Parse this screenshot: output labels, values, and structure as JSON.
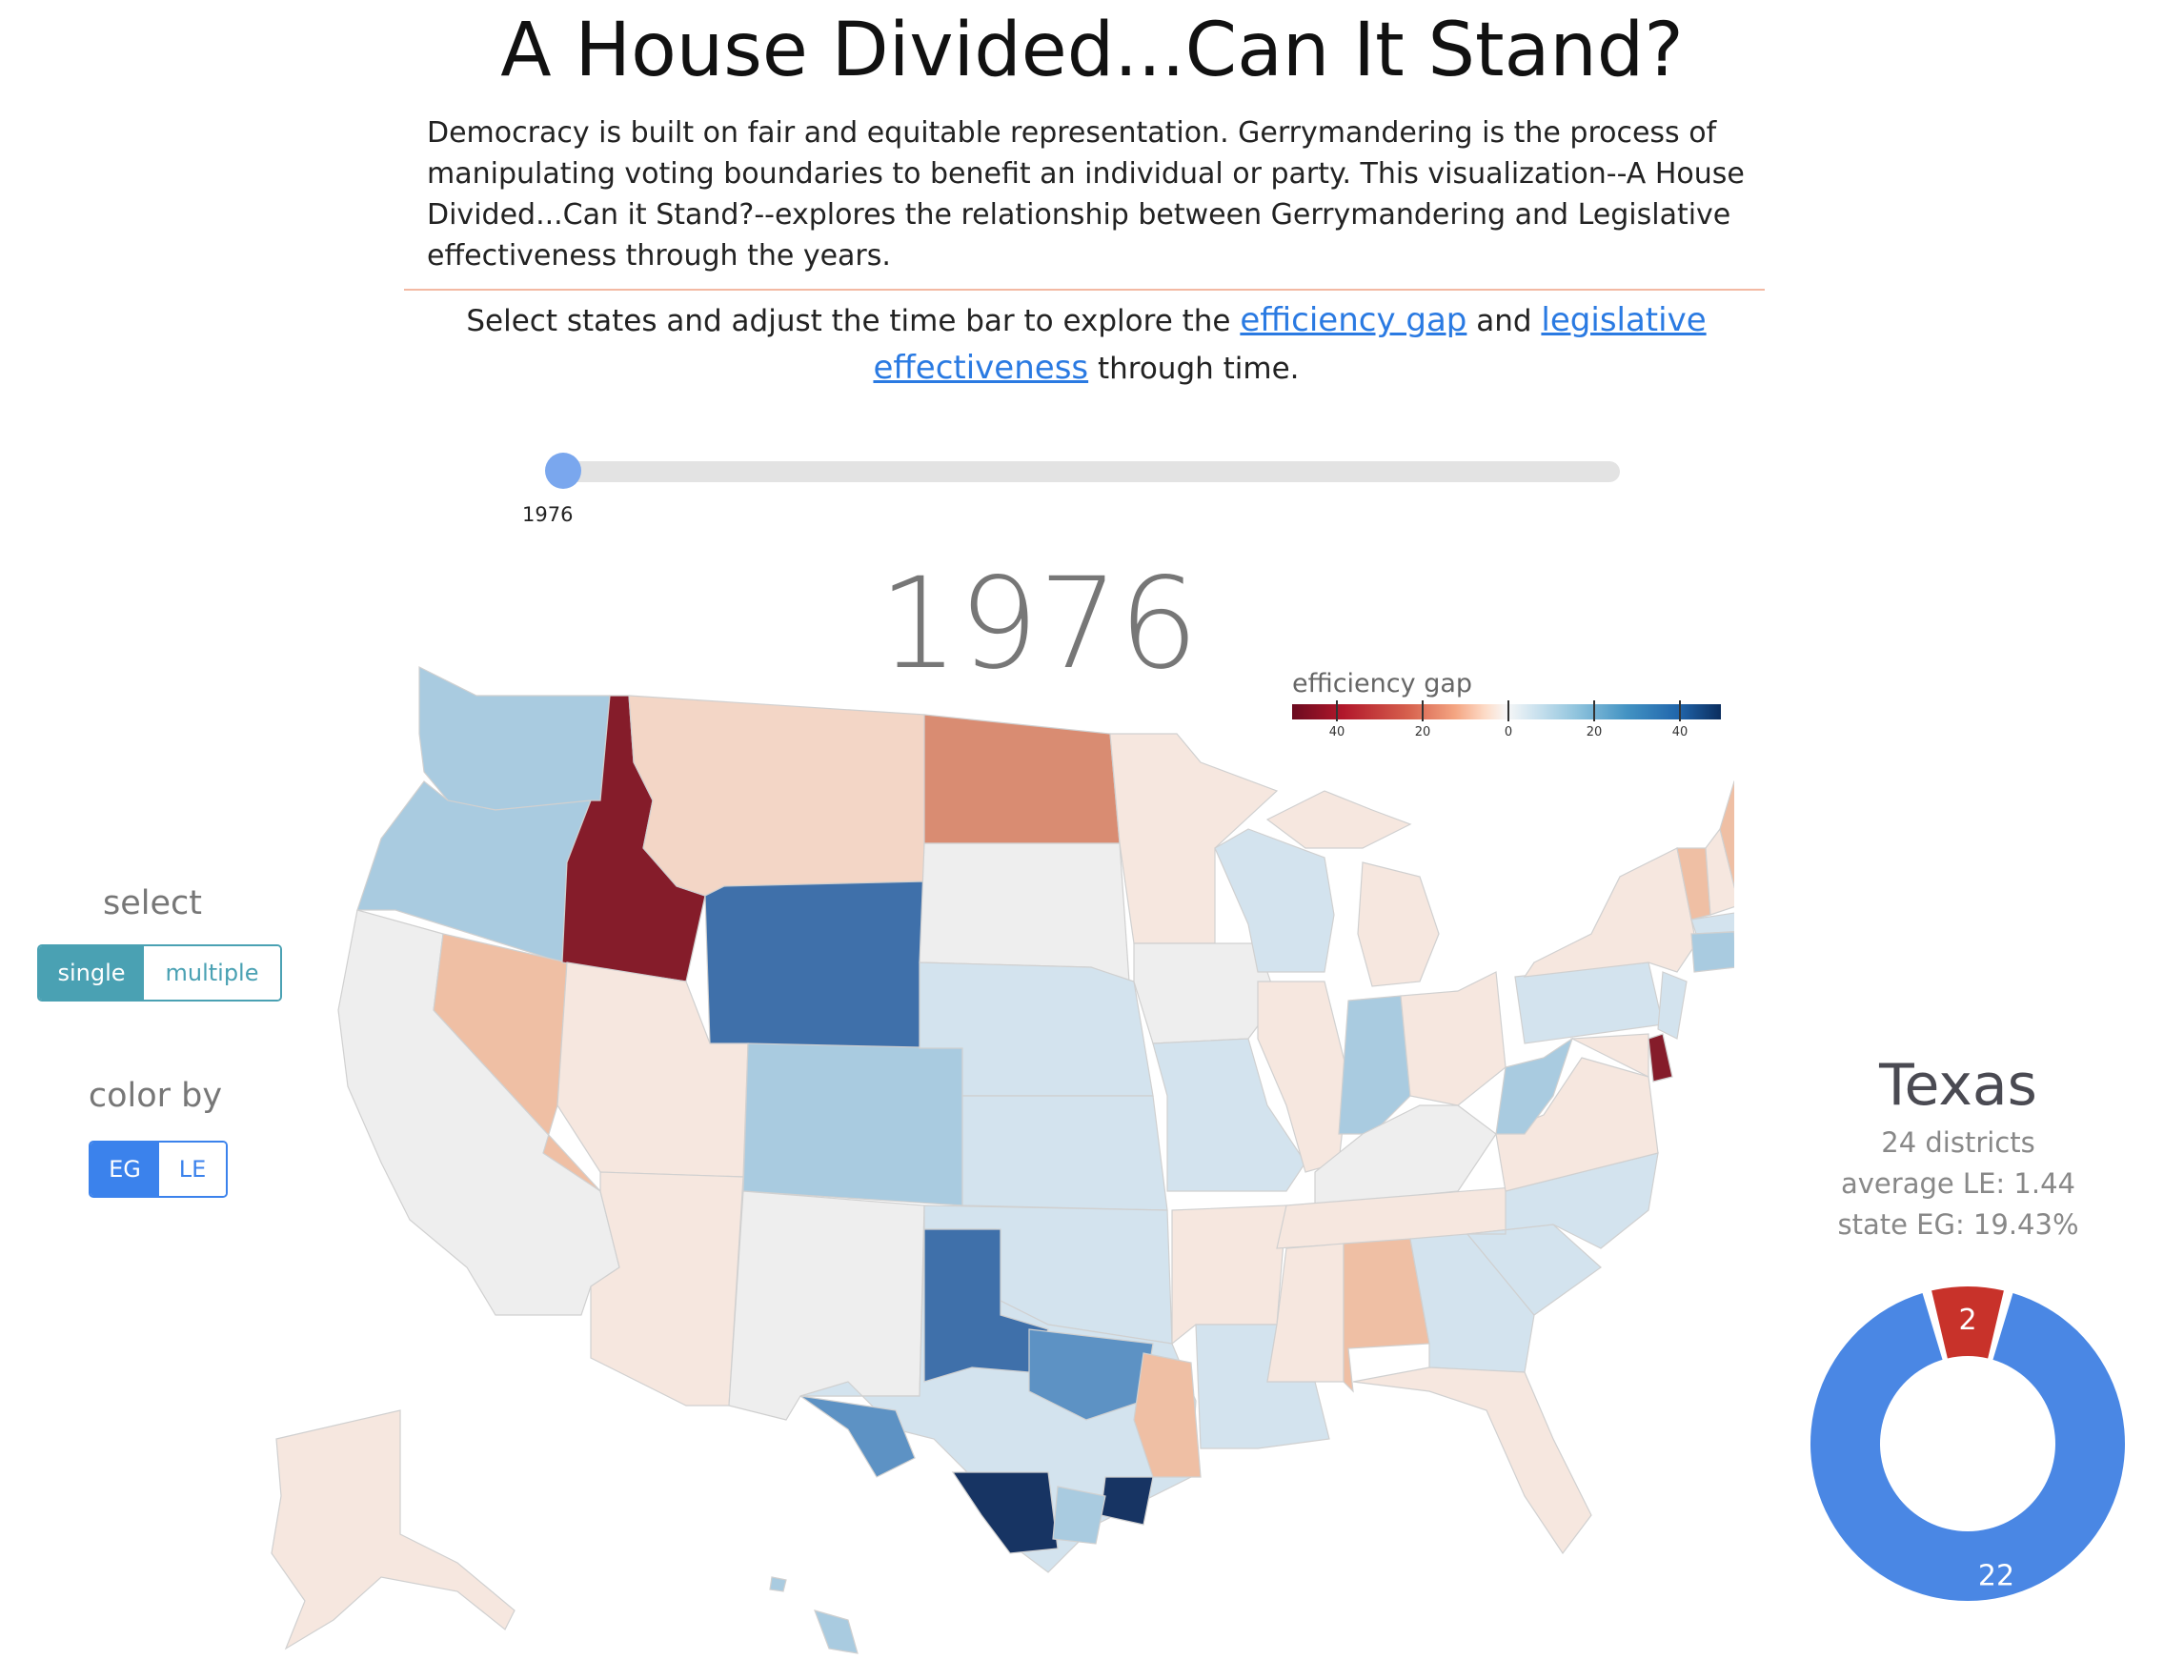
{
  "header": {
    "title": "A House Divided...Can It Stand?",
    "intro": "Democracy is built on fair and equitable representation. Gerrymandering is the process of manipulating voting boundaries to benefit an individual or party. This visualization--A House Divided...Can it Stand?--explores the relationship between Gerrymandering and Legislative effectiveness through the years.",
    "instruction_before": "Select states and adjust the time bar to explore the ",
    "link_efficiency_gap": "efficiency gap",
    "instruction_and": " and ",
    "link_legislative": "legislative effectiveness",
    "instruction_after": " through time."
  },
  "slider": {
    "year_label": "1976",
    "value_fraction": 0.0
  },
  "map": {
    "year": "1976",
    "legend_title": "efficiency gap",
    "legend_ticks": [
      "40",
      "20",
      "0",
      "20",
      "40"
    ],
    "colors": {
      "dark_red": "#851c2a",
      "red_mid": "#d98c72",
      "salmon": "#efbfa4",
      "peach": "#f3d6c6",
      "pale_peach": "#f6e7df",
      "neutral": "#eeeeee",
      "pale_blue": "#d3e3ee",
      "light_blue": "#a9cbe0",
      "mid_blue": "#5d92c4",
      "blue": "#3f70aa",
      "navy": "#173463"
    }
  },
  "controls": {
    "select_heading": "select",
    "select_single": "single",
    "select_multiple": "multiple",
    "color_by_heading": "color by",
    "color_eg": "EG",
    "color_le": "LE"
  },
  "state_panel": {
    "name": "Texas",
    "districts": "24 districts",
    "average_le": "average LE: 1.44",
    "state_eg": "state EG: 19.43%",
    "donut": {
      "segments": [
        {
          "label": "2",
          "value": 2,
          "color": "#c8322a"
        },
        {
          "label": "22",
          "value": 22,
          "color": "#4a87e4"
        }
      ]
    }
  }
}
